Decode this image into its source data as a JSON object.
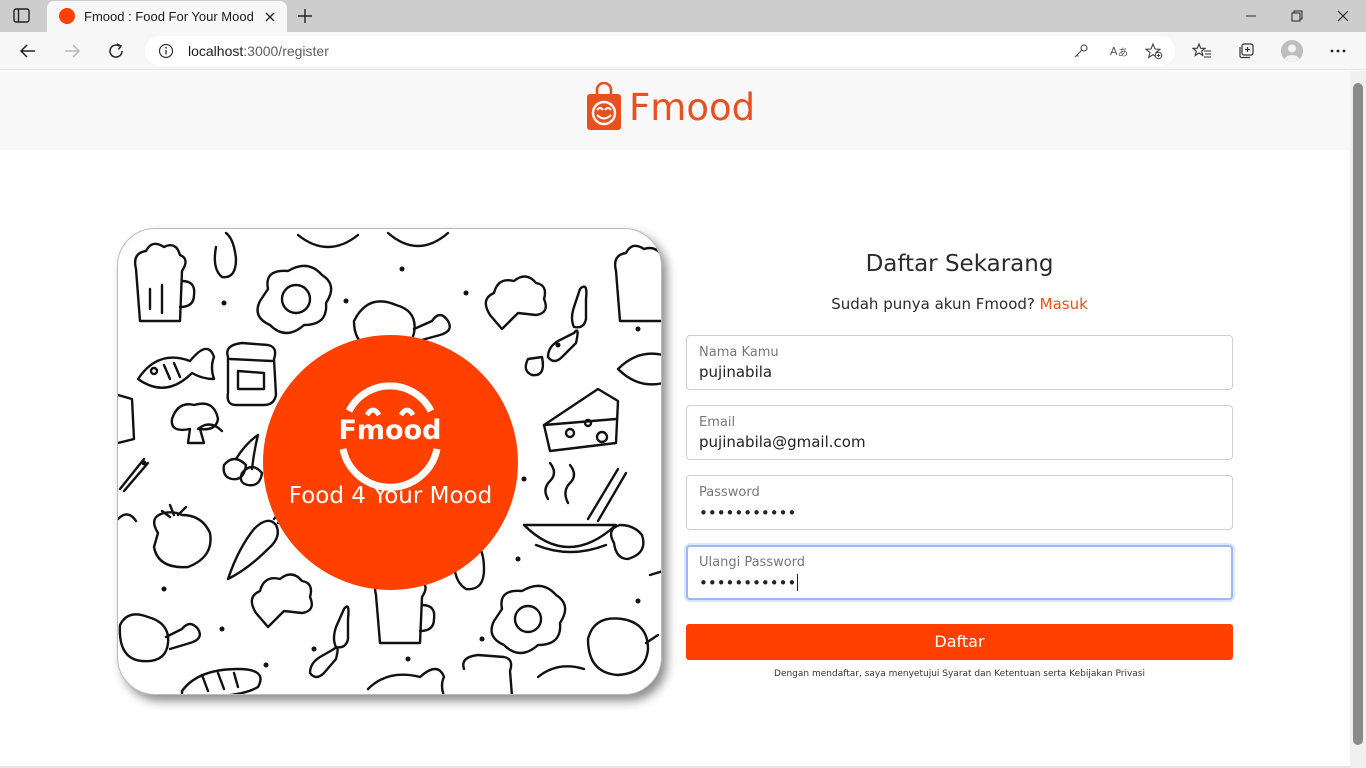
{
  "browser": {
    "tab_title": "Fmood : Food For Your Mood",
    "url_host": "localhost",
    "url_path": ":3000/register"
  },
  "header": {
    "brand": "Fmood"
  },
  "hero": {
    "logo_text": "Fmood",
    "tagline": "Food 4 Your Mood"
  },
  "form": {
    "title": "Daftar Sekarang",
    "subtitle": "Sudah punya akun Fmood?",
    "login_link": "Masuk",
    "fields": [
      {
        "label": "Nama Kamu",
        "value": "pujinabila"
      },
      {
        "label": "Email",
        "value": "pujinabila@gmail.com"
      },
      {
        "label": "Password",
        "value": "•••••••••••"
      },
      {
        "label": "Ulangi Password",
        "value": "•••••••••••"
      }
    ],
    "submit_label": "Daftar",
    "terms": "Dengan mendaftar, saya menyetujui Syarat dan Ketentuan serta Kebijakan Privasi"
  },
  "colors": {
    "accent": "#ff4000",
    "brand_text": "#e8501e"
  }
}
